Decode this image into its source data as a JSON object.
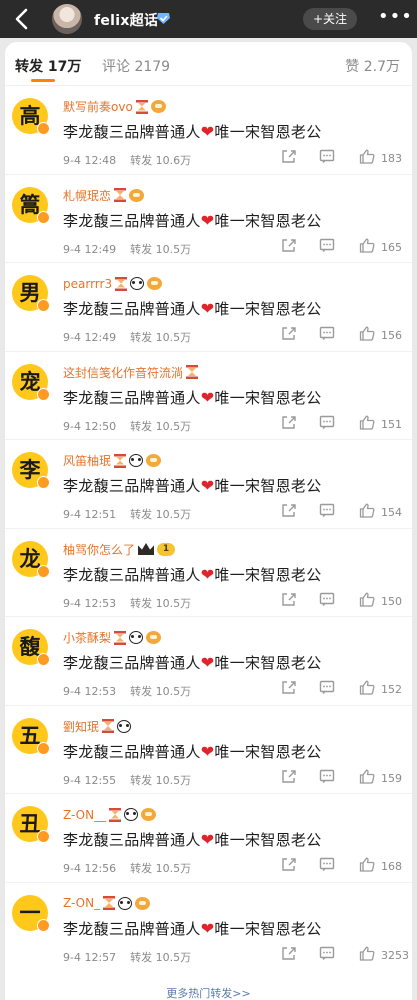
{
  "header": {
    "title": "felix超话",
    "follow_label": "+关注",
    "more_label": "•••",
    "back_icon": "chevron-left-icon",
    "verified_icon": "verified-badge-icon"
  },
  "tabs": {
    "reposts": "转发 17万",
    "comments": "评论 2179",
    "likes": "赞 2.7万"
  },
  "rows": [
    {
      "avatar_char": "高",
      "username": "默写前奏ovo",
      "badges": [
        "hourglass",
        "sun"
      ],
      "text_before": "李龙馥三品牌普通人",
      "text_after": "唯一宋智恩老公",
      "time": "9-4 12:48",
      "reposts": "转发 10.6万",
      "likes": "183"
    },
    {
      "avatar_char": "篙",
      "username": "札幌珉恋",
      "badges": [
        "hourglass",
        "sun"
      ],
      "text_before": "李龙馥三品牌普通人",
      "text_after": "唯一宋智恩老公",
      "time": "9-4 12:49",
      "reposts": "转发 10.5万",
      "likes": "165"
    },
    {
      "avatar_char": "男",
      "username": "pearrrr3",
      "badges": [
        "hourglass",
        "panda",
        "sun"
      ],
      "text_before": "李龙馥三品牌普通人",
      "text_after": "唯一宋智恩老公",
      "time": "9-4 12:49",
      "reposts": "转发 10.5万",
      "likes": "156"
    },
    {
      "avatar_char": "宠",
      "username": "这封信笺化作音符流淌",
      "badges": [
        "hourglass"
      ],
      "text_before": "李龙馥三品牌普通人",
      "text_after": "唯一宋智恩老公",
      "time": "9-4 12:50",
      "reposts": "转发 10.5万",
      "likes": "151"
    },
    {
      "avatar_char": "李",
      "username": "风笛柚珉",
      "badges": [
        "hourglass",
        "panda",
        "sun"
      ],
      "text_before": "李龙馥三品牌普通人",
      "text_after": "唯一宋智恩老公",
      "time": "9-4 12:51",
      "reposts": "转发 10.5万",
      "likes": "154"
    },
    {
      "avatar_char": "龙",
      "username": "柚骂你怎么了",
      "badges": [
        "crown",
        "level"
      ],
      "level_text": "1",
      "text_before": "李龙馥三品牌普通人",
      "text_after": "唯一宋智恩老公",
      "time": "9-4 12:53",
      "reposts": "转发 10.5万",
      "likes": "150"
    },
    {
      "avatar_char": "馥",
      "username": "小茶酥梨",
      "badges": [
        "hourglass",
        "panda",
        "sun"
      ],
      "text_before": "李龙馥三品牌普通人",
      "text_after": "唯一宋智恩老公",
      "time": "9-4 12:53",
      "reposts": "转发 10.5万",
      "likes": "152"
    },
    {
      "avatar_char": "五",
      "username": "劉知珉",
      "badges": [
        "hourglass",
        "panda"
      ],
      "text_before": "李龙馥三品牌普通人",
      "text_after": "唯一宋智恩老公",
      "time": "9-4 12:55",
      "reposts": "转发 10.5万",
      "likes": "159"
    },
    {
      "avatar_char": "丑",
      "username": "Z-ON__",
      "badges": [
        "hourglass",
        "panda",
        "sun"
      ],
      "text_before": "李龙馥三品牌普通人",
      "text_after": "唯一宋智恩老公",
      "time": "9-4 12:56",
      "reposts": "转发 10.5万",
      "likes": "168"
    },
    {
      "avatar_char": "一",
      "username": "Z-ON_",
      "badges": [
        "hourglass",
        "panda",
        "sun"
      ],
      "text_before": "李龙馥三品牌普通人",
      "text_after": "唯一宋智恩老公",
      "time": "9-4 12:57",
      "reposts": "转发 10.5万",
      "likes": "3253"
    }
  ],
  "heart_char": "❤",
  "footer_more": "更多热门转发>>",
  "colors": {
    "accent": "#ff8200",
    "username": "#e6742a",
    "avatar_bg": "#ffc81a",
    "heart": "#e0242c",
    "link": "#5b7ca8"
  }
}
